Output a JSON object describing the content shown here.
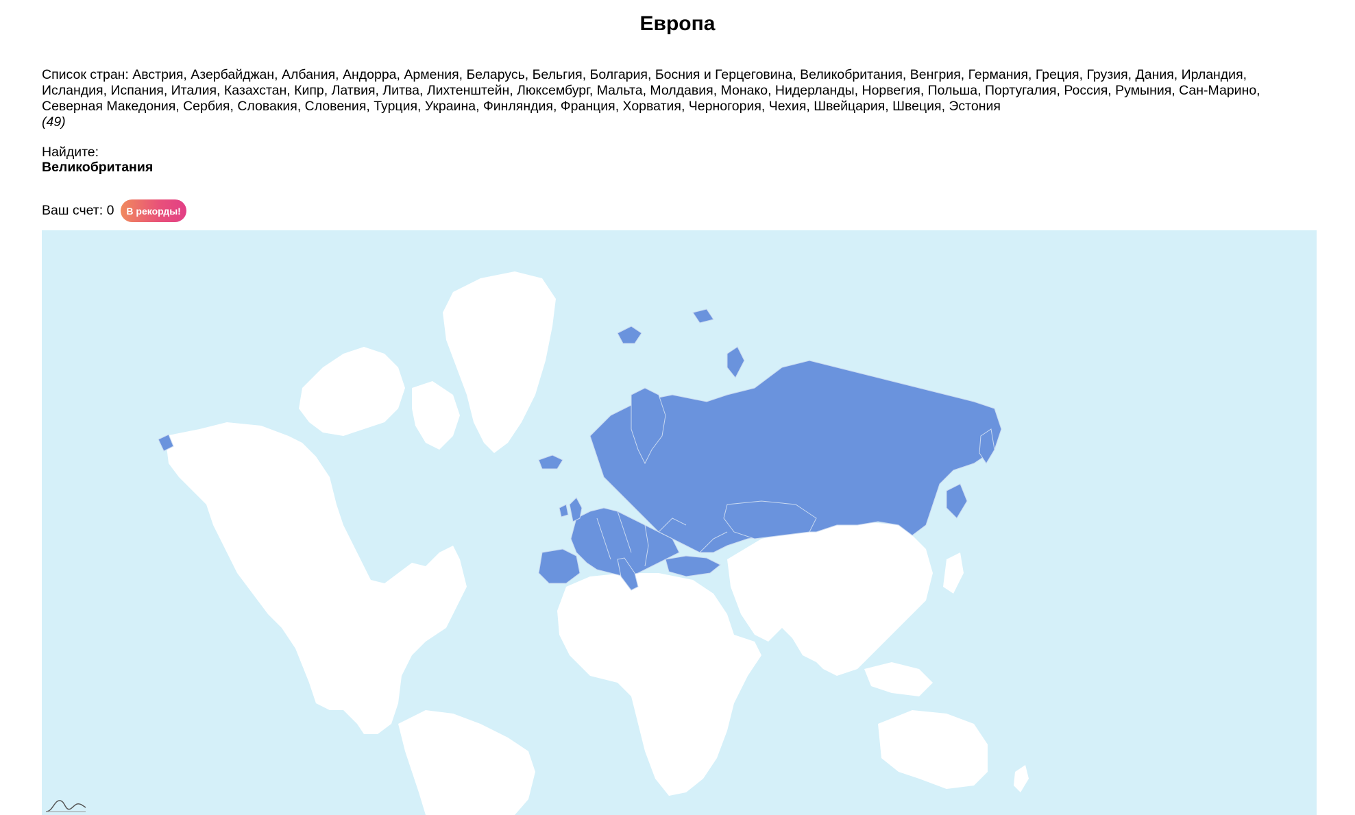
{
  "page": {
    "title": "Европа",
    "countries_prefix": "Список стран:",
    "countries": [
      "Австрия",
      "Азербайджан",
      "Албания",
      "Андорра",
      "Армения",
      "Беларусь",
      "Бельгия",
      "Болгария",
      "Босния и Герцеговина",
      "Великобритания",
      "Венгрия",
      "Германия",
      "Греция",
      "Грузия",
      "Дания",
      "Ирландия",
      "Исландия",
      "Испания",
      "Италия",
      "Казахстан",
      "Кипр",
      "Латвия",
      "Литва",
      "Лихтенштейн",
      "Люксембург",
      "Мальта",
      "Молдавия",
      "Монако",
      "Нидерланды",
      "Норвегия",
      "Польша",
      "Португалия",
      "Россия",
      "Румыния",
      "Сан-Марино",
      "Северная Македония",
      "Сербия",
      "Словакия",
      "Словения",
      "Турция",
      "Украина",
      "Финляндия",
      "Франция",
      "Хорватия",
      "Черногория",
      "Чехия",
      "Швейцария",
      "Швеция",
      "Эстония"
    ],
    "countries_text": "Список стран: Австрия, Азербайджан, Албания, Андорра, Армения, Беларусь, Бельгия, Болгария, Босния и Герцеговина, Великобритания, Венгрия, Германия, Греция, Грузия, Дания, Ирландия, Исландия, Испания, Италия, Казахстан, Кипр, Латвия, Литва, Лихтенштейн, Люксембург, Мальта, Молдавия, Монако, Нидерланды, Норвегия, Польша, Португалия, Россия, Румыния, Сан-Марино, Северная Македония, Сербия, Словакия, Словения, Турция, Украина, Финляндия, Франция, Хорватия, Черногория, Чехия, Швейцария, Швеция, Эстония",
    "count_label": "(49)"
  },
  "quiz": {
    "find_label": "Найдите:",
    "target_country": "Великобритания"
  },
  "score": {
    "label": "Ваш счет: 0",
    "records_button": "В рекорды!"
  },
  "map": {
    "ocean_color": "#d5f0f9",
    "land_color": "#ffffff",
    "highlight_color": "#6a93dd",
    "border_color": "#c9d9f0",
    "highlighted_region": "Европа",
    "logo_icon": "amcharts-logo-icon"
  }
}
